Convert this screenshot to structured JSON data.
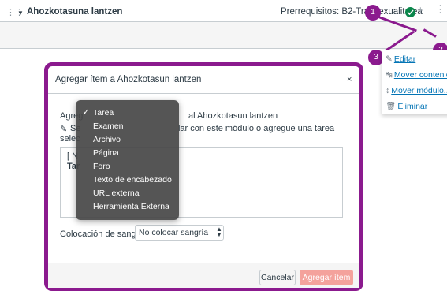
{
  "module": {
    "name": "Ahozkotasuna lantzen",
    "prerequisites": "Prerrequisitos: B2-Transexualitatea",
    "drag_icon": "drag-handle-icon",
    "caret_icon": "caret-down-icon",
    "add_icon": "plus-icon",
    "menu_icon": "kebab-icon"
  },
  "callouts": [
    "1",
    "2",
    "3"
  ],
  "context_menu": {
    "items": [
      {
        "label": "Editar",
        "icon": "pencil-icon"
      },
      {
        "label": "Mover contenid",
        "icon": "move-contents-icon"
      },
      {
        "label": "Mover módulo...",
        "icon": "move-module-icon"
      },
      {
        "label": "Eliminar",
        "icon": "trash-icon"
      }
    ]
  },
  "modal": {
    "title": "Agregar ítem a Ahozkotasun lantzen",
    "close": "×",
    "add_prefix": "Agreg",
    "add_module_suffix": "al Ahozkotasun lantzen",
    "instructions_icon": "✎",
    "instructions_prefix": "Se",
    "instructions_text": "lar con este módulo o agregue una tarea",
    "instructions_line2": "selec",
    "list_new": "[ N",
    "list_bold": "Tar",
    "indent_label": "Colocación de sangría:",
    "indent_value": "No colocar sangría",
    "cancel_label": "Cancelar",
    "add_label": "Agregar ítem"
  },
  "type_dropdown": {
    "selected": "Tarea",
    "check": "✓",
    "options": [
      "Tarea",
      "Examen",
      "Archivo",
      "Página",
      "Foro",
      "Texto de encabezado",
      "URL externa",
      "Herramienta Externa"
    ]
  },
  "colors": {
    "accent": "#8b1a8e",
    "check_green": "#0b874b",
    "link": "#0374b5",
    "primary_disabled": "#f4a29c"
  }
}
